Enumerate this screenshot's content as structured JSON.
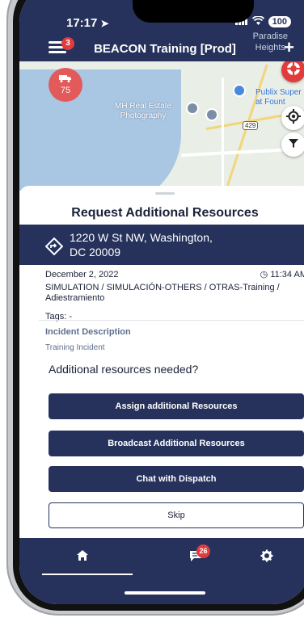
{
  "status_bar": {
    "time": "17:17",
    "battery": "100"
  },
  "header": {
    "title": "BEACON Training [Prod]",
    "menu_badge": "3",
    "location_label_line1": "Paradise",
    "location_label_line2": "Heights"
  },
  "map": {
    "unit_count": "75",
    "labels": {
      "real_estate_line1": "MH Real Estate",
      "real_estate_line2": "Photography",
      "publix_line1": "Publix Super",
      "publix_line2": "at Fount",
      "highway": "429"
    }
  },
  "sheet": {
    "title": "Request Additional Resources",
    "address_line1": "1220 W St NW, Washington,",
    "address_line2": "DC 20009",
    "priority": "75",
    "date": "December 2, 2022",
    "time": "11:34 AM",
    "incident_type_line1": "SIMULATION / SIMULACIÓN-OTHERS / OTRAS-Training /",
    "incident_type_line2": "Adiestramiento",
    "tags": "Tags: -",
    "description_heading": "Incident Description",
    "description_text": "Training Incident",
    "question": "Additional resources needed?",
    "buttons": {
      "assign": "Assign additional Resources",
      "broadcast": "Broadcast Additional Resources",
      "chat": "Chat with Dispatch",
      "skip": "Skip"
    }
  },
  "bottom_nav": {
    "chat_badge": "26"
  },
  "colors": {
    "primary": "#26325c",
    "alert": "#e23b3b",
    "priority": "#e25a5a"
  }
}
